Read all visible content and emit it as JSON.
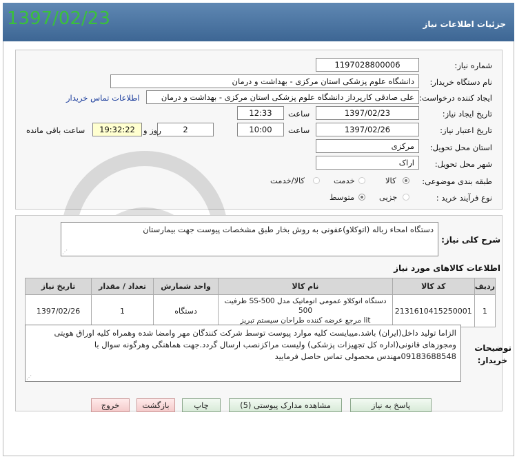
{
  "header": {
    "title": "جزئیات اطلاعات نیاز",
    "date_overlay": "1397/02/23"
  },
  "form": {
    "need_number_label": "شماره نیاز:",
    "need_number": "1197028800006",
    "buyer_org_label": "نام دستگاه خریدار:",
    "buyer_org": "دانشگاه علوم پزشکی  استان مرکزی - بهداشت و درمان",
    "requester_label": "ایجاد کننده درخواست:",
    "requester": "علی صادقی کارپرداز دانشگاه علوم پزشکی  استان مرکزی - بهداشت و درمان",
    "contact_link": "اطلاعات تماس خریدار",
    "created_label": "تاریخ ایجاد نیاز:",
    "created_date": "1397/02/23",
    "time_label": "ساعت",
    "created_time": "12:33",
    "valid_label": "تاریخ اعتبار نیاز:",
    "valid_date": "1397/02/26",
    "valid_time_label": "ساعت",
    "valid_time": "10:00",
    "days_value": "2",
    "days_label": "روز و",
    "remaining_time": "19:32:22",
    "remaining_label": "ساعت باقی مانده",
    "province_label": "استان محل تحویل:",
    "province": "مرکزی",
    "city_label": "شهر محل تحویل:",
    "city": "اراک",
    "category_label": "طبقه بندی موضوعی:",
    "category_options": [
      "کالا",
      "خدمت",
      "کالا/خدمت"
    ],
    "process_label": "نوع فرآیند خرید :",
    "process_options": [
      "جزیی",
      "متوسط"
    ]
  },
  "description": {
    "label": "شرح کلی نیاز:",
    "text": "دستگاه امحاء زباله (اتوکلاو)عفونی به روش بخار طبق مشخصات پیوست جهت بیمارستان"
  },
  "goods": {
    "title": "اطلاعات کالاهای مورد نیاز",
    "columns": [
      "ردیف",
      "کد کالا",
      "نام کالا",
      "واحد شمارش",
      "تعداد / مقدار",
      "تاریخ نیاز"
    ],
    "rows": [
      {
        "row": "1",
        "code": "2131610415250001",
        "name_line1": "دستگاه اتوکلاو عمومی اتوماتیک مدل SS-500 ظرفیت 500",
        "name_line2": "lit مرجع عرضه کننده طراحان سیستم تبریز",
        "unit": "دستگاه",
        "qty": "1",
        "date": "1397/02/26"
      }
    ]
  },
  "buyer_notes": {
    "label_line1": "توضیحات",
    "label_line2": "خریدار:",
    "line1": "الزاما تولید داخل(ایران) باشد.میبایست کلیه موارد پیوست توسط شرکت کنندگان مهر وامضا شده وهمراه کلیه اوراق هویتی",
    "line2": "ومجوزهای قانونی(اداره کل تجهیزات پزشکی)  ولیست مراکزنصب  ارسال گردد.جهت هماهنگی وهرگونه سوال با",
    "line3": "09183688548مهندس محصولی تماس حاصل فرمایید"
  },
  "buttons": {
    "respond": "پاسخ به نیاز",
    "attachments": "مشاهده مدارک پیوستی (5)",
    "print": "چاپ",
    "back": "بازگشت",
    "exit": "خروج"
  },
  "colors": {
    "header": "#4a74a2",
    "date_overlay": "#3ac13a",
    "link": "#1a3c9c",
    "remaining_bg": "#ffffd0"
  }
}
